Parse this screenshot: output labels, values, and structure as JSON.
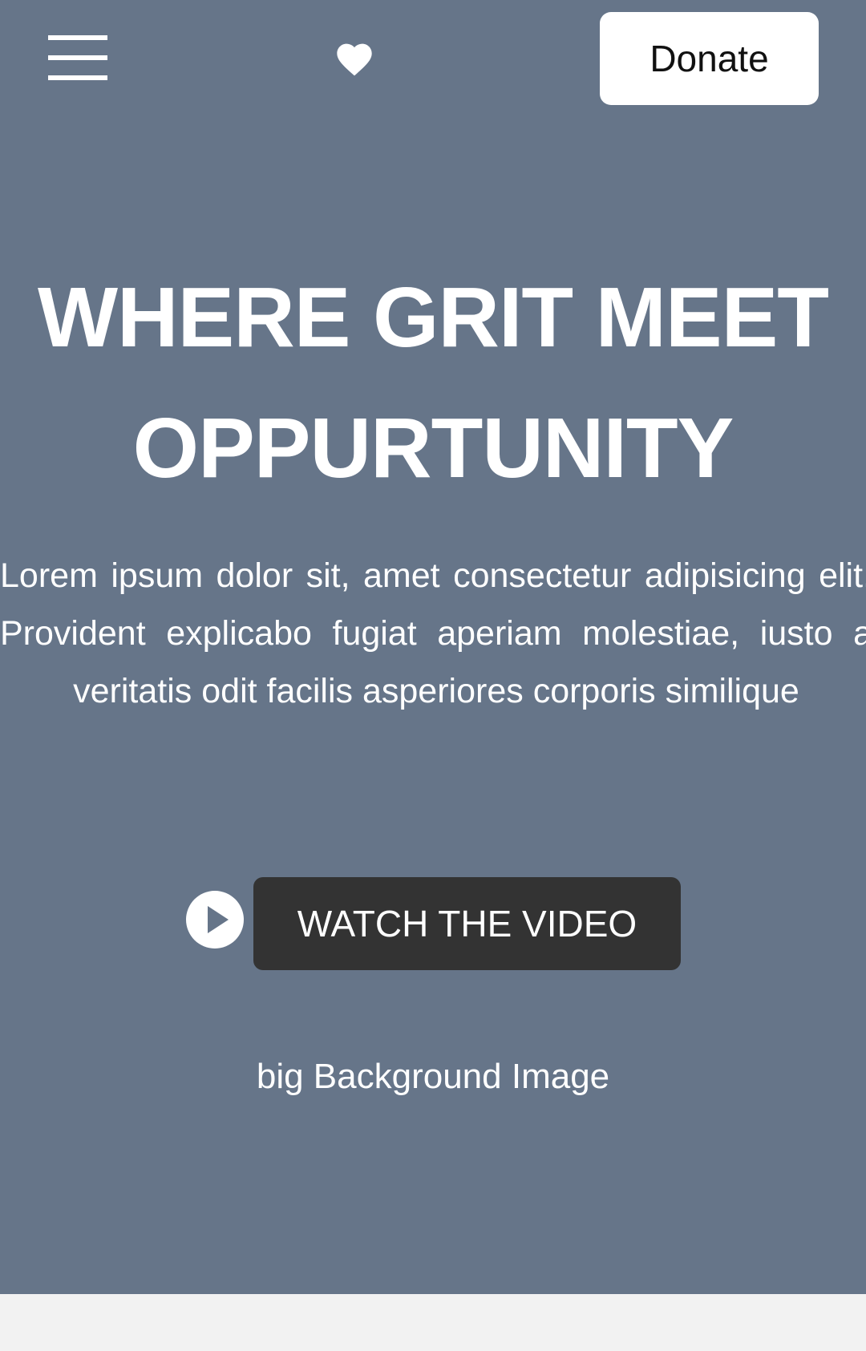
{
  "header": {
    "menu_icon": "hamburger-menu-icon",
    "heart_icon": "heart-icon",
    "donate_label": "Donate"
  },
  "hero": {
    "headline": "WHERE GRIT MEET OPPURTUNITY",
    "intro": "Lorem ipsum dolor sit, amet consectetur adipisicing elit. Provident explicabo fugiat aperiam molestiae, iusto a veritatis odit facilis asperiores corporis similique",
    "play_icon": "play-circle-icon",
    "watch_label": "WATCH THE VIDEO",
    "bg_caption": "big Background Image"
  },
  "colors": {
    "hero_background": "#667589",
    "page_background": "#f2f2f2",
    "donate_background": "#ffffff",
    "watch_button_background": "#333333",
    "text_light": "#ffffff"
  }
}
